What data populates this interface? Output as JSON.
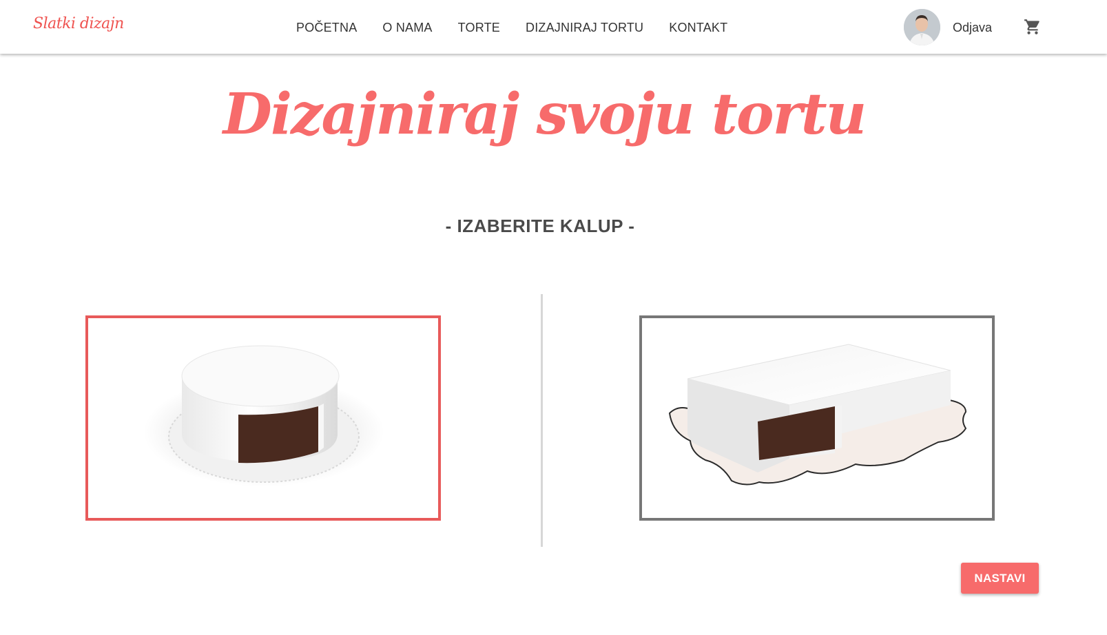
{
  "header": {
    "logo": "Slatki dizajn",
    "nav": [
      "POČETNA",
      "O NAMA",
      "TORTE",
      "DIZAJNIRAJ TORTU",
      "KONTAKT"
    ],
    "logout": "Odjava",
    "cart_icon": "cart-icon",
    "avatar_icon": "user-avatar"
  },
  "main": {
    "title": "Dizajniraj svoju tortu",
    "subtitle": "- IZABERITE KALUP -",
    "molds": [
      {
        "shape": "round",
        "selected": true
      },
      {
        "shape": "rectangle",
        "selected": false
      }
    ],
    "continue_label": "NASTAVI"
  },
  "colors": {
    "accent": "#f76b6b",
    "selected_border": "#e85a5a",
    "unselected_border": "#777777"
  }
}
